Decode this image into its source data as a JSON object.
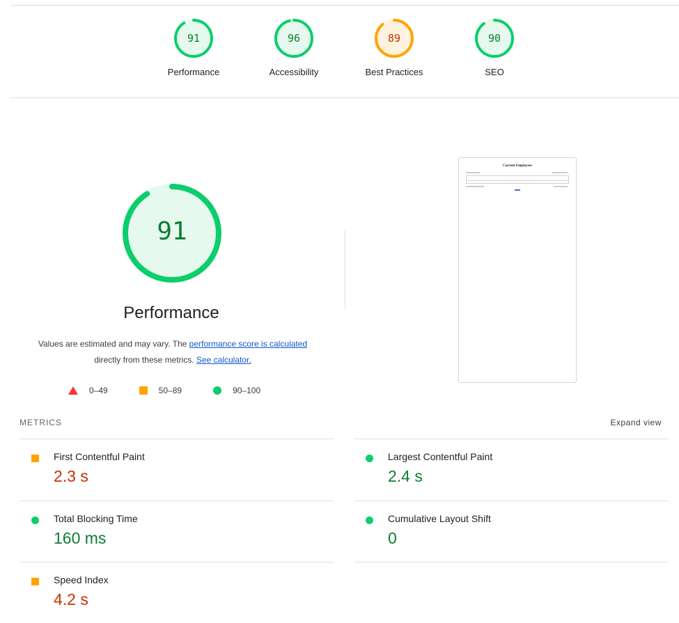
{
  "categories": [
    {
      "score": "91",
      "label": "Performance",
      "status": "pass",
      "fraction": 0.91,
      "color": "#0cce6b"
    },
    {
      "score": "96",
      "label": "Accessibility",
      "status": "pass",
      "fraction": 0.96,
      "color": "#0cce6b"
    },
    {
      "score": "89",
      "label": "Best Practices",
      "status": "average",
      "fraction": 0.89,
      "color": "#ffa400"
    },
    {
      "score": "90",
      "label": "SEO",
      "status": "pass",
      "fraction": 0.9,
      "color": "#0cce6b"
    }
  ],
  "performance": {
    "score": "91",
    "fraction": 0.91,
    "title": "Performance",
    "desc_prefix": "Values are estimated and may vary. The ",
    "desc_link1": "performance score is calculated",
    "desc_middle": " directly from these metrics. ",
    "desc_link2": "See calculator."
  },
  "legend": {
    "fail": "0–49",
    "average": "50–89",
    "pass": "90–100"
  },
  "screenshot": {
    "title": "Current Employees"
  },
  "metrics": {
    "heading": "METRICS",
    "expand_label": "Expand view",
    "items": [
      {
        "name": "First Contentful Paint",
        "value": "2.3 s",
        "status": "average"
      },
      {
        "name": "Largest Contentful Paint",
        "value": "2.4 s",
        "status": "pass"
      },
      {
        "name": "Total Blocking Time",
        "value": "160 ms",
        "status": "pass"
      },
      {
        "name": "Cumulative Layout Shift",
        "value": "0",
        "status": "pass"
      },
      {
        "name": "Speed Index",
        "value": "4.2 s",
        "status": "average"
      }
    ]
  },
  "colors": {
    "pass": "#0cce6b",
    "pass_text": "#0c7d32",
    "average": "#ffa400",
    "average_text": "#c33300",
    "fail": "#ff3333",
    "link": "#1155cc"
  }
}
